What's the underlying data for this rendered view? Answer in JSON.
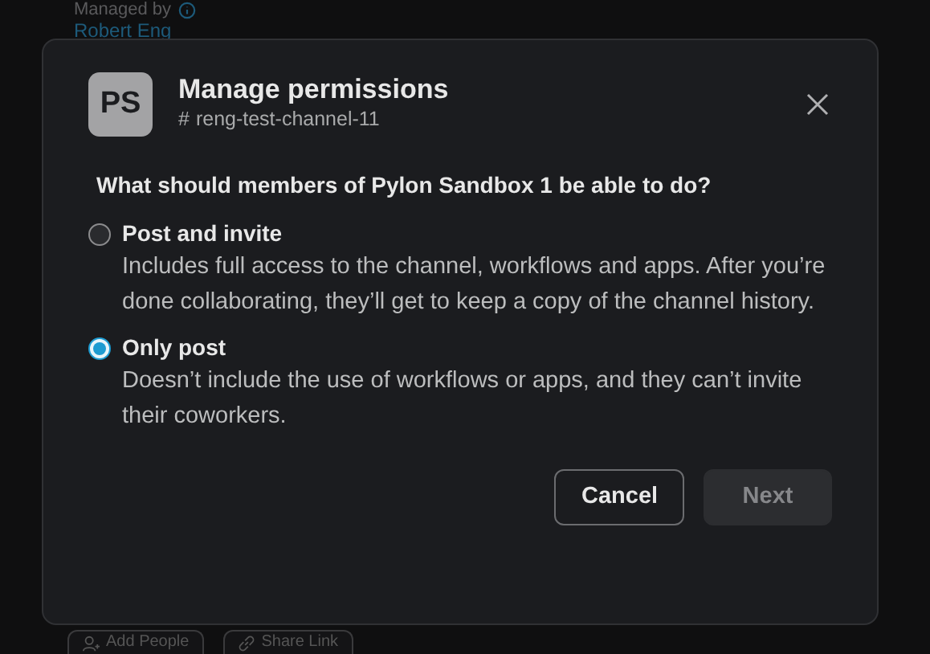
{
  "background": {
    "managed_by_label": "Managed by",
    "owner": "Robert Eng",
    "buttons": [
      {
        "label": "Add People",
        "kind": "person"
      },
      {
        "label": "Share Link",
        "kind": "link"
      }
    ]
  },
  "dialog": {
    "avatar": "PS",
    "title": "Manage permissions",
    "channel_prefix": "#",
    "channel": "reng-test-channel-11",
    "question": "What should members of Pylon Sandbox 1 be able to do?",
    "options": [
      {
        "label": "Post and invite",
        "description": "Includes full access to the channel, workflows and apps. After you’re done collaborating, they’ll get to keep a copy of the channel history.",
        "selected": false
      },
      {
        "label": "Only post",
        "description": "Doesn’t include the use of workflows or apps, and they can’t invite their coworkers.",
        "selected": true
      }
    ],
    "buttons": [
      {
        "label": "Cancel",
        "kind": "secondary",
        "disabled": false
      },
      {
        "label": "Next",
        "kind": "primary",
        "disabled": true
      }
    ]
  }
}
